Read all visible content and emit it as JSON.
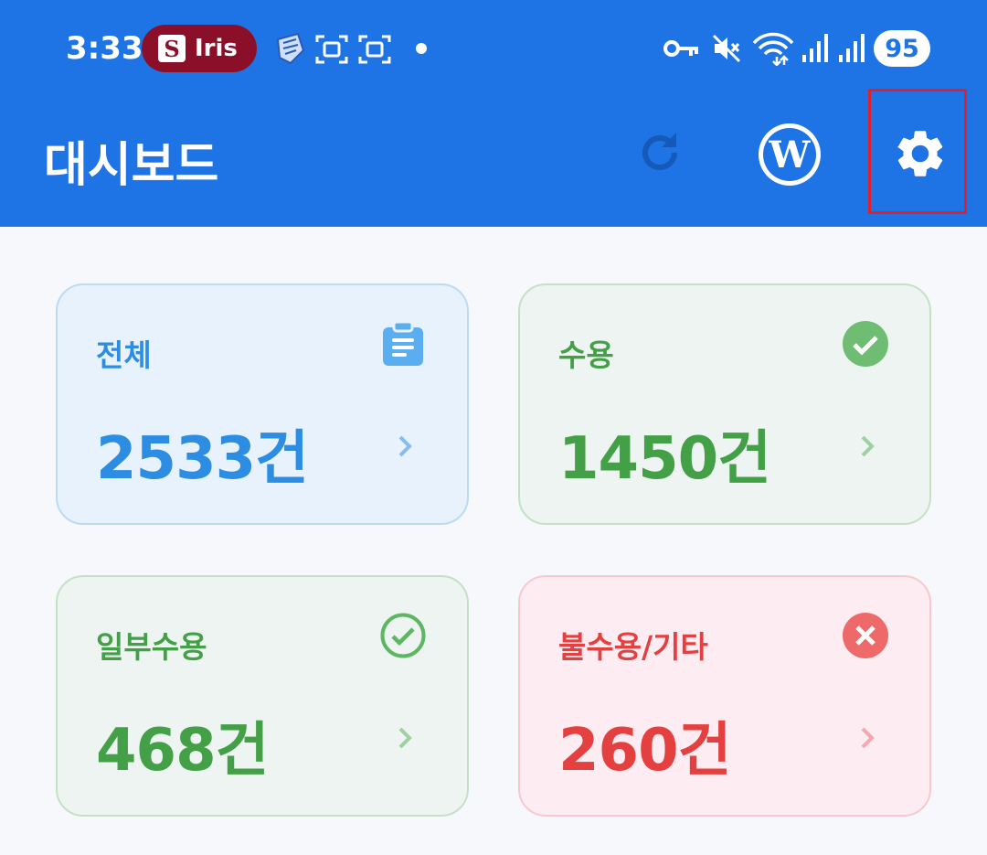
{
  "status_bar": {
    "time": "3:33",
    "notification_app": "Iris",
    "notification_logo": "S",
    "battery": "95",
    "icons": [
      "key-icon",
      "mute-icon",
      "wifi-icon",
      "signal-icon",
      "signal-icon"
    ]
  },
  "appbar": {
    "title": "대시보드",
    "actions": [
      "refresh-icon",
      "wordpress-icon",
      "gear-icon"
    ],
    "color": "#1e74e4"
  },
  "cards": [
    {
      "label": "전체",
      "value": "2533건",
      "icon": "clipboard-icon",
      "color": "#2c8de2",
      "bg": "#e8f2fd",
      "border": "#b9dbf6"
    },
    {
      "label": "수용",
      "value": "1450건",
      "icon": "check-circle-icon",
      "color": "#43a047",
      "bg": "#edf4f1",
      "border": "#c4e1c8"
    },
    {
      "label": "일부수용",
      "value": "468건",
      "icon": "check-circle-outline-icon",
      "color": "#43a047",
      "bg": "#edf4f1",
      "border": "#c4e1c8"
    },
    {
      "label": "불수용/기타",
      "value": "260건",
      "icon": "cancel-circle-icon",
      "color": "#e54040",
      "bg": "#fdedf2",
      "border": "#f7c9cf"
    }
  ]
}
